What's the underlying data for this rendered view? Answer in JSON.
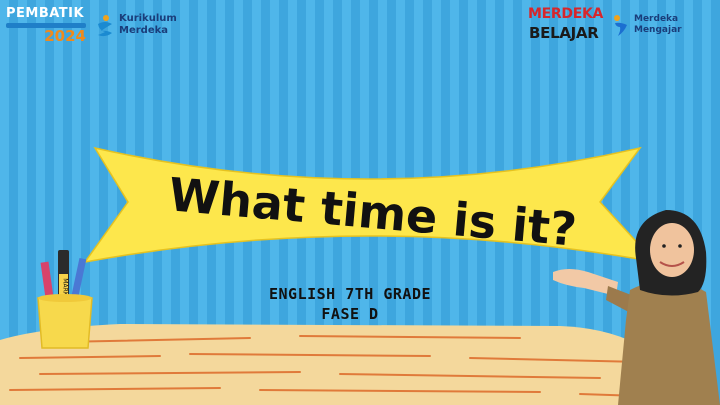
{
  "logos": {
    "pembatik": {
      "title": "PEMBATIK",
      "year": "2024"
    },
    "kurikulum": {
      "line1": "Kurikulum",
      "line2": "Merdeka"
    },
    "merdeka_belajar": {
      "line1": "MERDEKA",
      "line2": "BELAJAR"
    },
    "merdeka_mengajar": {
      "line1": "Merdeka",
      "line2": "Mengajar"
    }
  },
  "slide": {
    "title": "What time is it?",
    "subtitle_line1": "ENGLISH 7TH GRADE",
    "subtitle_line2": "FASE D",
    "pencil_label": "MARK"
  },
  "colors": {
    "background": "#4fb6ea",
    "stripe": "#3ea6de",
    "banner": "#fde74c",
    "title_text": "#111111",
    "desk": "#f4d89c",
    "desk_lines": "#e07a3a"
  }
}
